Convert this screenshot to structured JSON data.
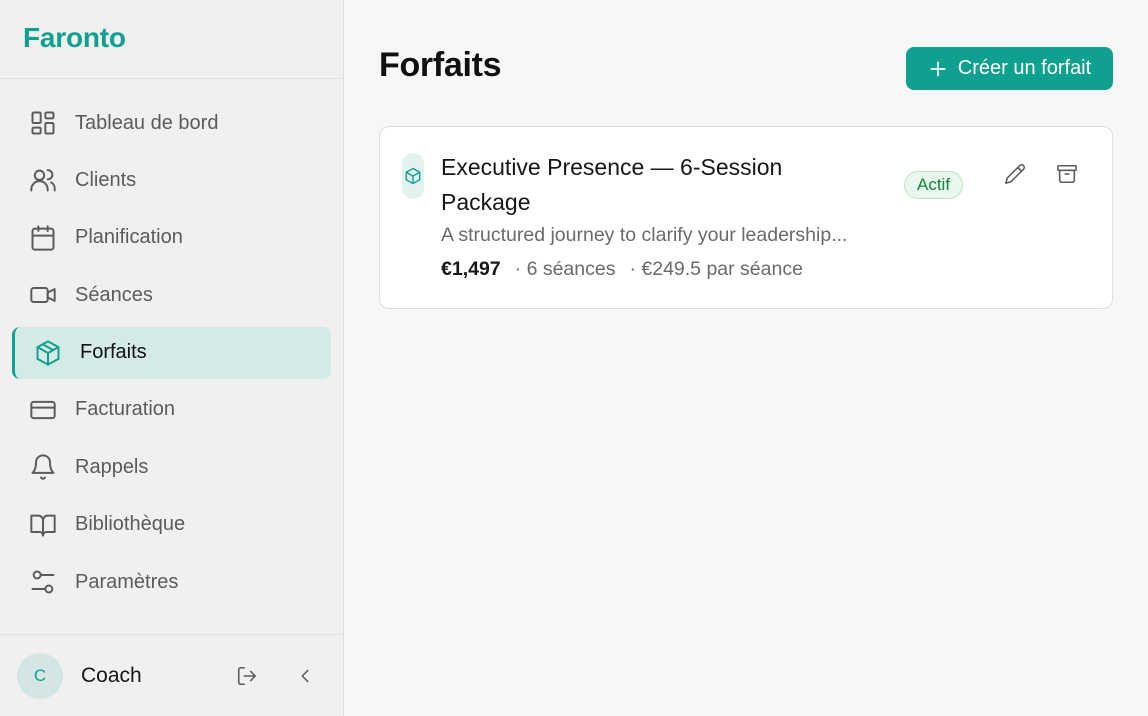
{
  "brand": "Faronto",
  "sidebar": {
    "items": [
      {
        "label": "Tableau de bord",
        "icon": "dashboard-icon"
      },
      {
        "label": "Clients",
        "icon": "users-icon"
      },
      {
        "label": "Planification",
        "icon": "calendar-icon"
      },
      {
        "label": "Séances",
        "icon": "video-icon"
      },
      {
        "label": "Forfaits",
        "icon": "package-icon",
        "active": true
      },
      {
        "label": "Facturation",
        "icon": "credit-card-icon"
      },
      {
        "label": "Rappels",
        "icon": "bell-icon"
      },
      {
        "label": "Bibliothèque",
        "icon": "book-icon"
      },
      {
        "label": "Paramètres",
        "icon": "sliders-icon"
      }
    ],
    "user": {
      "initial": "C",
      "name": "Coach"
    }
  },
  "main": {
    "title": "Forfaits",
    "create_label": "Créer un forfait"
  },
  "packages": [
    {
      "title": "Executive Presence — 6-Session Package",
      "description": "A structured journey to clarify your leadership...",
      "price": "€1,497",
      "sessions": "· 6 séances",
      "per_session": "· €249.5 par séance",
      "status": "Actif"
    }
  ],
  "colors": {
    "accent": "#10a090",
    "active_bg": "#d5e9e6",
    "badge_text": "#13863f"
  }
}
